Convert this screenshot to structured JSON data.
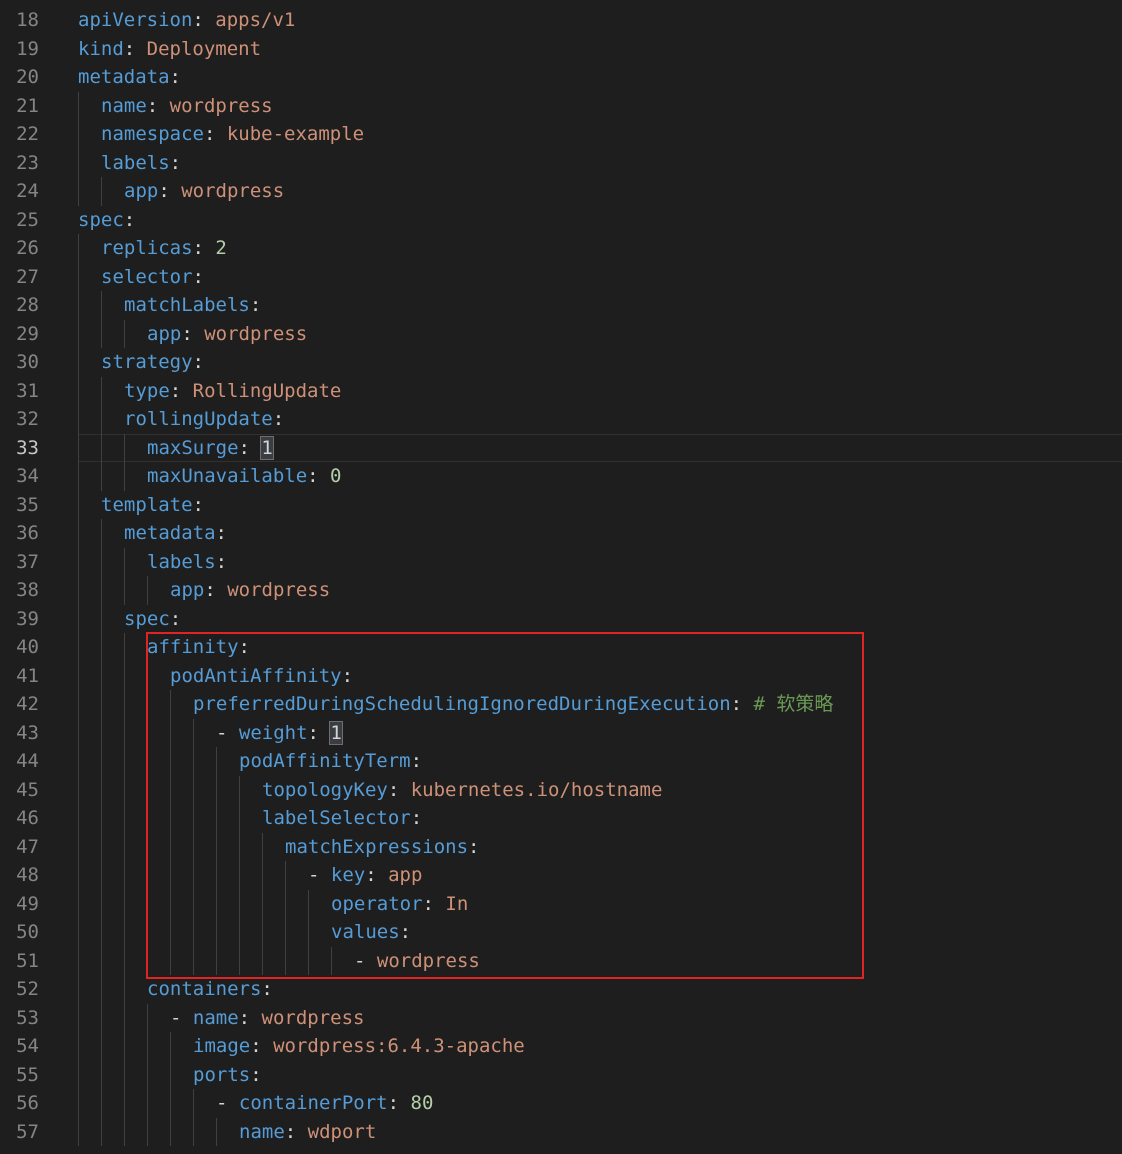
{
  "editor": {
    "first_line_number": 18,
    "current_line": 33,
    "highlight_box_color": "#e02424",
    "lines": [
      {
        "indent": 0,
        "guides": 0,
        "tokens": [
          [
            "k",
            "apiVersion"
          ],
          [
            "p",
            ": "
          ],
          [
            "s",
            "apps/v1"
          ]
        ]
      },
      {
        "indent": 0,
        "guides": 0,
        "tokens": [
          [
            "k",
            "kind"
          ],
          [
            "p",
            ": "
          ],
          [
            "s",
            "Deployment"
          ]
        ]
      },
      {
        "indent": 0,
        "guides": 0,
        "tokens": [
          [
            "k",
            "metadata"
          ],
          [
            "p",
            ":"
          ]
        ]
      },
      {
        "indent": 1,
        "guides": 1,
        "tokens": [
          [
            "k",
            "name"
          ],
          [
            "p",
            ": "
          ],
          [
            "s",
            "wordpress"
          ]
        ]
      },
      {
        "indent": 1,
        "guides": 1,
        "tokens": [
          [
            "k",
            "namespace"
          ],
          [
            "p",
            ": "
          ],
          [
            "s",
            "kube-example"
          ]
        ]
      },
      {
        "indent": 1,
        "guides": 1,
        "tokens": [
          [
            "k",
            "labels"
          ],
          [
            "p",
            ":"
          ]
        ]
      },
      {
        "indent": 2,
        "guides": 2,
        "tokens": [
          [
            "k",
            "app"
          ],
          [
            "p",
            ": "
          ],
          [
            "s",
            "wordpress"
          ]
        ]
      },
      {
        "indent": 0,
        "guides": 0,
        "tokens": [
          [
            "k",
            "spec"
          ],
          [
            "p",
            ":"
          ]
        ]
      },
      {
        "indent": 1,
        "guides": 1,
        "tokens": [
          [
            "k",
            "replicas"
          ],
          [
            "p",
            ": "
          ],
          [
            "n",
            "2"
          ]
        ]
      },
      {
        "indent": 1,
        "guides": 1,
        "tokens": [
          [
            "k",
            "selector"
          ],
          [
            "p",
            ":"
          ]
        ]
      },
      {
        "indent": 2,
        "guides": 2,
        "tokens": [
          [
            "k",
            "matchLabels"
          ],
          [
            "p",
            ":"
          ]
        ]
      },
      {
        "indent": 3,
        "guides": 3,
        "tokens": [
          [
            "k",
            "app"
          ],
          [
            "p",
            ": "
          ],
          [
            "s",
            "wordpress"
          ]
        ]
      },
      {
        "indent": 1,
        "guides": 1,
        "tokens": [
          [
            "k",
            "strategy"
          ],
          [
            "p",
            ":"
          ]
        ]
      },
      {
        "indent": 2,
        "guides": 2,
        "tokens": [
          [
            "k",
            "type"
          ],
          [
            "p",
            ": "
          ],
          [
            "s",
            "RollingUpdate"
          ]
        ]
      },
      {
        "indent": 2,
        "guides": 2,
        "tokens": [
          [
            "k",
            "rollingUpdate"
          ],
          [
            "p",
            ":"
          ]
        ]
      },
      {
        "indent": 3,
        "guides": 3,
        "tokens": [
          [
            "k",
            "maxSurge"
          ],
          [
            "p",
            ": "
          ],
          [
            "bm",
            "1"
          ]
        ]
      },
      {
        "indent": 3,
        "guides": 3,
        "tokens": [
          [
            "k",
            "maxUnavailable"
          ],
          [
            "p",
            ": "
          ],
          [
            "n",
            "0"
          ]
        ]
      },
      {
        "indent": 1,
        "guides": 1,
        "tokens": [
          [
            "k",
            "template"
          ],
          [
            "p",
            ":"
          ]
        ]
      },
      {
        "indent": 2,
        "guides": 2,
        "tokens": [
          [
            "k",
            "metadata"
          ],
          [
            "p",
            ":"
          ]
        ]
      },
      {
        "indent": 3,
        "guides": 3,
        "tokens": [
          [
            "k",
            "labels"
          ],
          [
            "p",
            ":"
          ]
        ]
      },
      {
        "indent": 4,
        "guides": 4,
        "tokens": [
          [
            "k",
            "app"
          ],
          [
            "p",
            ": "
          ],
          [
            "s",
            "wordpress"
          ]
        ]
      },
      {
        "indent": 2,
        "guides": 2,
        "tokens": [
          [
            "k",
            "spec"
          ],
          [
            "p",
            ":"
          ]
        ]
      },
      {
        "indent": 3,
        "guides": 3,
        "tokens": [
          [
            "k",
            "affinity"
          ],
          [
            "p",
            ":"
          ]
        ]
      },
      {
        "indent": 4,
        "guides": 4,
        "tokens": [
          [
            "k",
            "podAntiAffinity"
          ],
          [
            "p",
            ":"
          ]
        ]
      },
      {
        "indent": 5,
        "guides": 5,
        "tokens": [
          [
            "k",
            "preferredDuringSchedulingIgnoredDuringExecution"
          ],
          [
            "p",
            ": "
          ],
          [
            "c",
            "# 软策略"
          ]
        ]
      },
      {
        "indent": 6,
        "guides": 6,
        "tokens": [
          [
            "p",
            "- "
          ],
          [
            "k",
            "weight"
          ],
          [
            "p",
            ": "
          ],
          [
            "bm",
            "1"
          ]
        ]
      },
      {
        "indent": 7,
        "guides": 7,
        "tokens": [
          [
            "k",
            "podAffinityTerm"
          ],
          [
            "p",
            ":"
          ]
        ]
      },
      {
        "indent": 8,
        "guides": 8,
        "tokens": [
          [
            "k",
            "topologyKey"
          ],
          [
            "p",
            ": "
          ],
          [
            "s",
            "kubernetes.io/hostname"
          ]
        ]
      },
      {
        "indent": 8,
        "guides": 8,
        "tokens": [
          [
            "k",
            "labelSelector"
          ],
          [
            "p",
            ":"
          ]
        ]
      },
      {
        "indent": 9,
        "guides": 9,
        "tokens": [
          [
            "k",
            "matchExpressions"
          ],
          [
            "p",
            ":"
          ]
        ]
      },
      {
        "indent": 10,
        "guides": 10,
        "tokens": [
          [
            "p",
            "- "
          ],
          [
            "k",
            "key"
          ],
          [
            "p",
            ": "
          ],
          [
            "s",
            "app"
          ]
        ]
      },
      {
        "indent": 11,
        "guides": 11,
        "tokens": [
          [
            "k",
            "operator"
          ],
          [
            "p",
            ": "
          ],
          [
            "s",
            "In"
          ]
        ]
      },
      {
        "indent": 11,
        "guides": 11,
        "tokens": [
          [
            "k",
            "values"
          ],
          [
            "p",
            ":"
          ]
        ]
      },
      {
        "indent": 12,
        "guides": 12,
        "tokens": [
          [
            "p",
            "- "
          ],
          [
            "s",
            "wordpress"
          ]
        ]
      },
      {
        "indent": 3,
        "guides": 3,
        "tokens": [
          [
            "k",
            "containers"
          ],
          [
            "p",
            ":"
          ]
        ]
      },
      {
        "indent": 4,
        "guides": 4,
        "tokens": [
          [
            "p",
            "- "
          ],
          [
            "k",
            "name"
          ],
          [
            "p",
            ": "
          ],
          [
            "s",
            "wordpress"
          ]
        ]
      },
      {
        "indent": 5,
        "guides": 5,
        "tokens": [
          [
            "k",
            "image"
          ],
          [
            "p",
            ": "
          ],
          [
            "s",
            "wordpress:6.4.3-apache"
          ]
        ]
      },
      {
        "indent": 5,
        "guides": 5,
        "tokens": [
          [
            "k",
            "ports"
          ],
          [
            "p",
            ":"
          ]
        ]
      },
      {
        "indent": 6,
        "guides": 6,
        "tokens": [
          [
            "p",
            "- "
          ],
          [
            "k",
            "containerPort"
          ],
          [
            "p",
            ": "
          ],
          [
            "n",
            "80"
          ]
        ]
      },
      {
        "indent": 7,
        "guides": 7,
        "tokens": [
          [
            "k",
            "name"
          ],
          [
            "p",
            ": "
          ],
          [
            "s",
            "wdport"
          ]
        ]
      }
    ]
  }
}
